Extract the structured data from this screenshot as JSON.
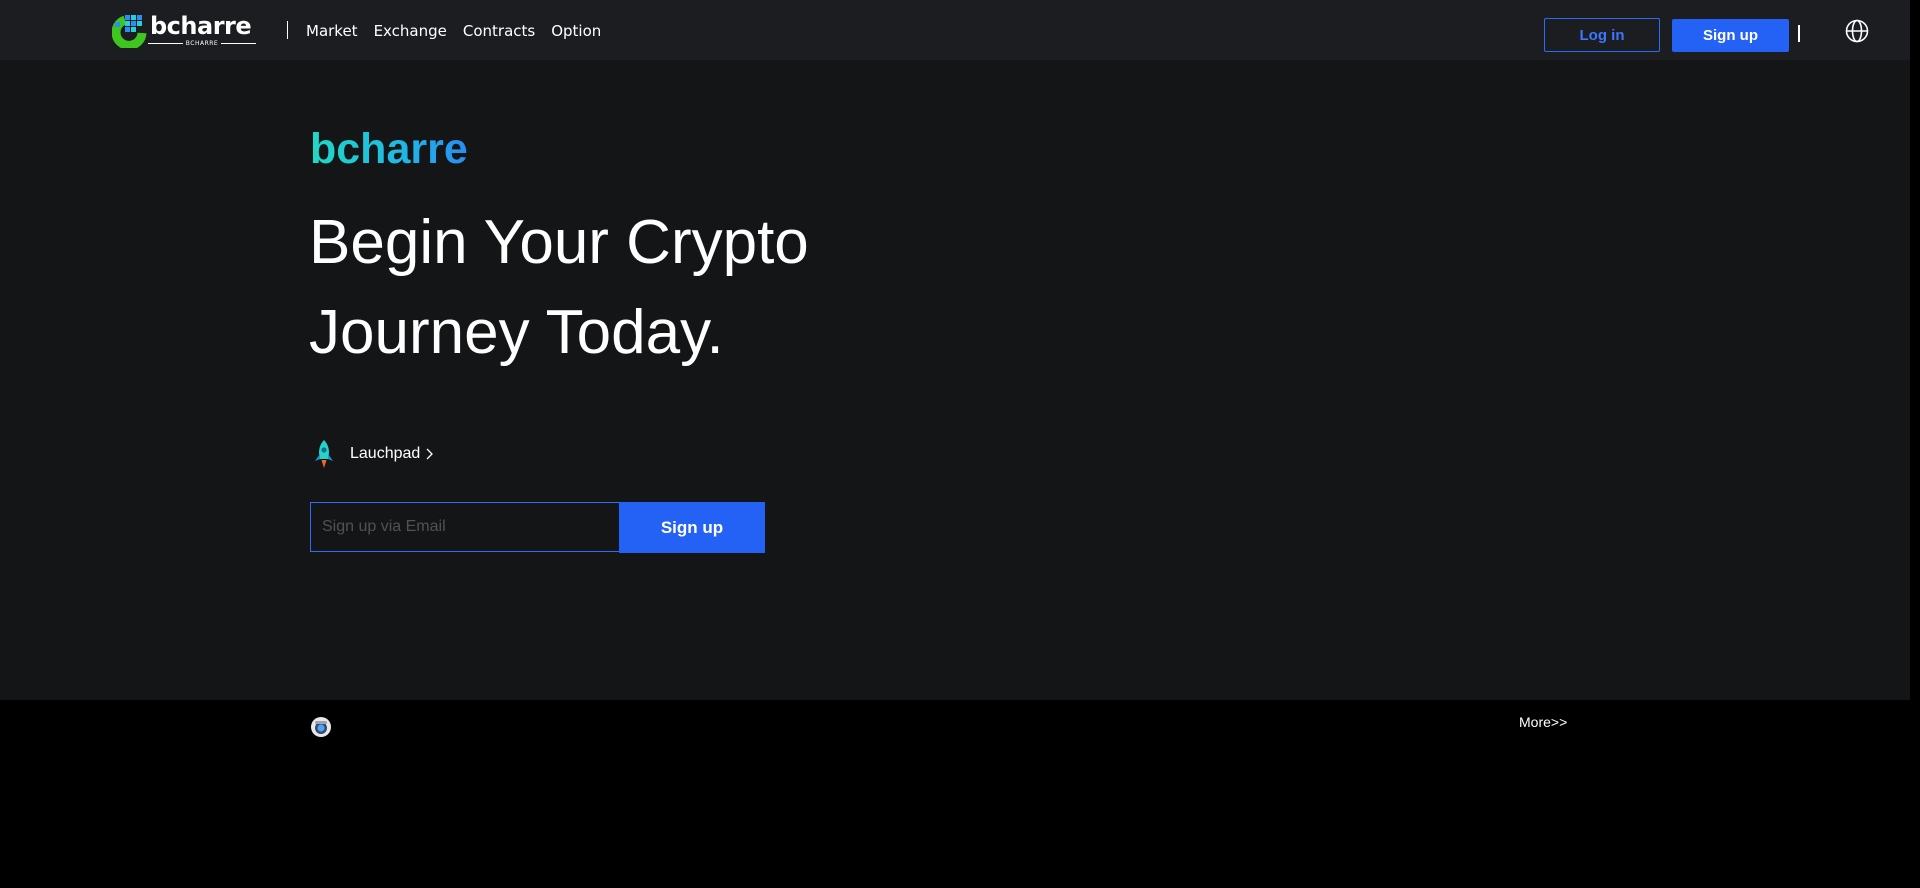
{
  "header": {
    "logo": {
      "word": "bcharre",
      "subtext": "BCHARRE"
    },
    "nav": [
      {
        "label": "Market"
      },
      {
        "label": "Exchange"
      },
      {
        "label": "Contracts"
      },
      {
        "label": "Option"
      }
    ],
    "login_label": "Log in",
    "signup_label": "Sign up",
    "language_icon": "globe-icon"
  },
  "hero": {
    "brand": "bcharre",
    "headline_line1": "Begin Your Crypto",
    "headline_line2": "Journey Today.",
    "launchpad_label": "Lauchpad",
    "email_placeholder": "Sign up via Email",
    "email_value": "",
    "signup_label": "Sign up"
  },
  "footer": {
    "more_label": "More>>"
  },
  "colors": {
    "accent_blue": "#2462f5",
    "brand_gradient_start": "#20d8c4",
    "brand_gradient_end": "#2a8cf0",
    "topbar_bg": "#1b1d21",
    "hero_bg": "#141517"
  }
}
